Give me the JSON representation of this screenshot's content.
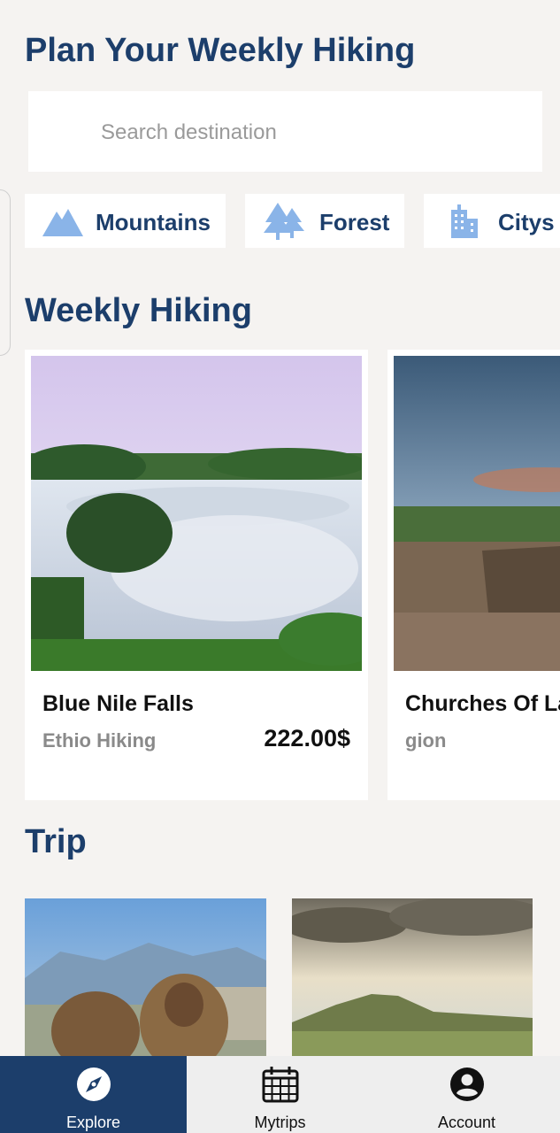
{
  "header": {
    "title": "Plan Your Weekly Hiking"
  },
  "search": {
    "placeholder": "Search destination",
    "value": ""
  },
  "categories": [
    {
      "label": "Mountains",
      "icon": "mountain-icon"
    },
    {
      "label": "Forest",
      "icon": "forest-icon"
    },
    {
      "label": "Citys",
      "icon": "city-icon"
    }
  ],
  "weekly": {
    "title": "Weekly Hiking",
    "cards": [
      {
        "name": "Blue Nile Falls",
        "org": "Ethio Hiking",
        "price": "222.00$"
      },
      {
        "name": "Churches Of La",
        "org": "gion",
        "price": ""
      }
    ]
  },
  "trip": {
    "title": "Trip"
  },
  "nav": [
    {
      "label": "Explore",
      "icon": "compass-icon",
      "active": true
    },
    {
      "label": "Mytrips",
      "icon": "calendar-icon",
      "active": false
    },
    {
      "label": "Account",
      "icon": "account-icon",
      "active": false
    }
  ],
  "colors": {
    "primary": "#1c3e6b",
    "icon_light_blue": "#8ab4e8",
    "background": "#f5f3f1",
    "nav_active": "#1c3e6b"
  }
}
